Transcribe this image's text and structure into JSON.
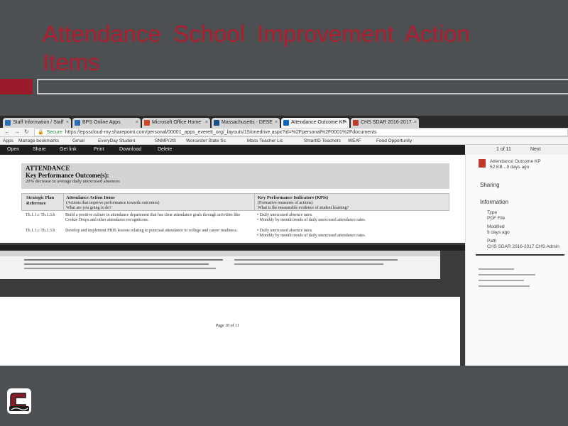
{
  "slide": {
    "title": "Attendance School Improvement Action Items"
  },
  "browser": {
    "tabs": [
      {
        "label": "Staff Information / Staff"
      },
      {
        "label": "BPS Online Apps"
      },
      {
        "label": "Microsoft Office Home"
      },
      {
        "label": "Massachusetts - DESE"
      },
      {
        "label": "Attendance Outcome KP"
      },
      {
        "label": "CHS SDAR 2016-2017"
      }
    ],
    "secure_label": "Secure",
    "url": "https://epsscloud-my.sharepoint.com/personal/00001_apps_everett_org/_layouts/15/onedrive.aspx?id=%2Fpersonal%2F0001%2Fdocuments",
    "bookmarks": [
      "Apps",
      "Manage bookmarks",
      "Gmail",
      "EveryDay Student",
      "SNMP/JIS",
      "Worcester State Sc",
      "Mass Teacher Lic",
      "SmartID Teachers",
      "WEAF",
      "Food Opportunity"
    ],
    "toolbar": [
      "Open",
      "Share",
      "Get link",
      "Print",
      "Download",
      "Delete"
    ],
    "pager": {
      "page": "1 of 11",
      "next": "Next"
    }
  },
  "document": {
    "section": "ATTENDANCE",
    "kpo_label": "Key Performance Outcome(s):",
    "kpo_value": "20% decrease in average daily unexcused absences",
    "col1": {
      "title": "Strategic Plan Reference"
    },
    "col2": {
      "title": "Attendance Action Items",
      "sub": "(Actions that improve performance towards outcomes)",
      "q": "What are you going to do?"
    },
    "col3": {
      "title": "Key Performance Indicators (KPIs)",
      "sub": "(Formative measures of actions)",
      "q": "What is the measurable evidence of student learning?"
    },
    "rows": [
      {
        "ref": "Th.1.1.c Th.1.3.b",
        "action": "Build a positive culture in attendance department that has clear attendance goals through activities like Cookie Drops and other attendance recognitions.",
        "kpi1": "Daily unexcused absence rates.",
        "kpi2": "Monthly by month trends of daily unexcused attendance rates."
      },
      {
        "ref": "Th.1.1.c Th.1.3.b",
        "action": "Develop and implement PBIS lessons relating to punctual attendance to college and career readiness.",
        "kpi1": "Daily unexcused absence rates.",
        "kpi2": "Monthly by month trends of daily unexcused attendance rates."
      }
    ],
    "footer": "Page 10 of 11"
  },
  "panel": {
    "file_name": "Attendance Outcome KP",
    "file_size": "52 KB - 9 days ago",
    "sharing_label": "Sharing",
    "info_label": "Information",
    "type_label": "Type",
    "type_value": "PDF File",
    "modified_label": "Modified",
    "modified_value": "9 days ago",
    "path_label": "Path",
    "path_value": "CHS SDAR 2016-2017 CHS Admin"
  },
  "colors": {
    "title_red": "#b01d2e",
    "accent_red": "#9b1b2a",
    "slide_bg": "#4d5052"
  },
  "icons": [
    "back-icon",
    "forward-icon",
    "reload-icon",
    "lock-icon",
    "pdf-file-icon",
    "chs-logo"
  ]
}
